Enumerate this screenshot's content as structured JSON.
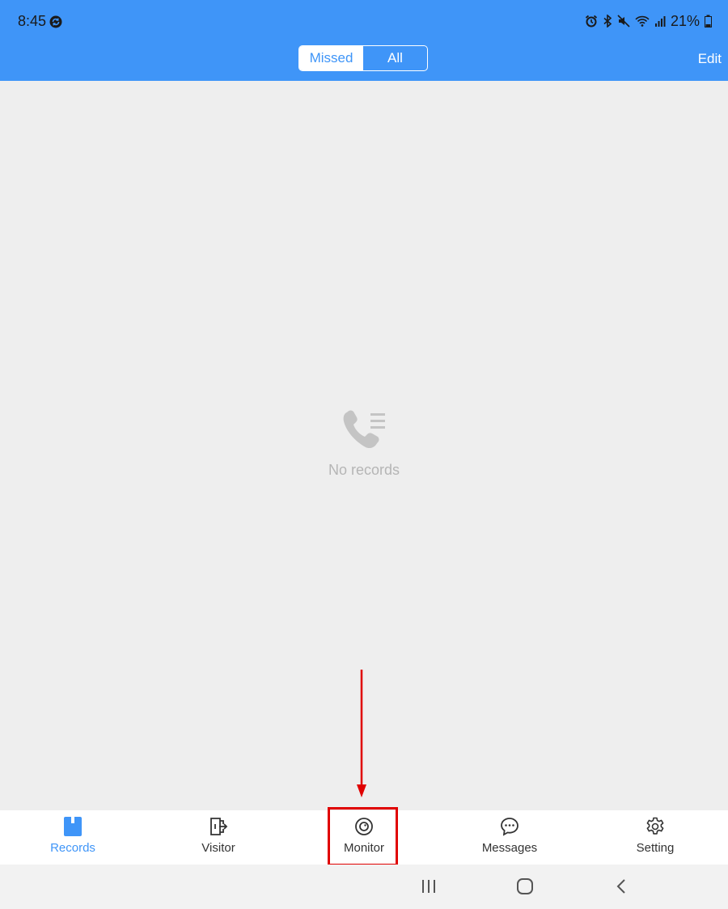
{
  "status_bar": {
    "time": "8:45",
    "battery": "21%"
  },
  "header": {
    "segments": [
      {
        "label": "Missed",
        "active": true
      },
      {
        "label": "All",
        "active": false
      }
    ],
    "edit_label": "Edit",
    "accent_color": "#3f95f8"
  },
  "empty_state": {
    "icon": "phone-list-icon",
    "text": "No records"
  },
  "tabbar": {
    "tabs": [
      {
        "label": "Records",
        "icon": "records-icon",
        "active": true
      },
      {
        "label": "Visitor",
        "icon": "visitor-door-icon",
        "active": false
      },
      {
        "label": "Monitor",
        "icon": "monitor-camera-icon",
        "active": false
      },
      {
        "label": "Messages",
        "icon": "chat-bubble-icon",
        "active": false
      },
      {
        "label": "Setting",
        "icon": "gear-icon",
        "active": false
      }
    ]
  },
  "annotation": {
    "highlight_color": "#e00000",
    "target": "Monitor"
  },
  "system_nav": {
    "buttons": [
      "recent-apps-icon",
      "home-icon",
      "back-icon"
    ]
  }
}
